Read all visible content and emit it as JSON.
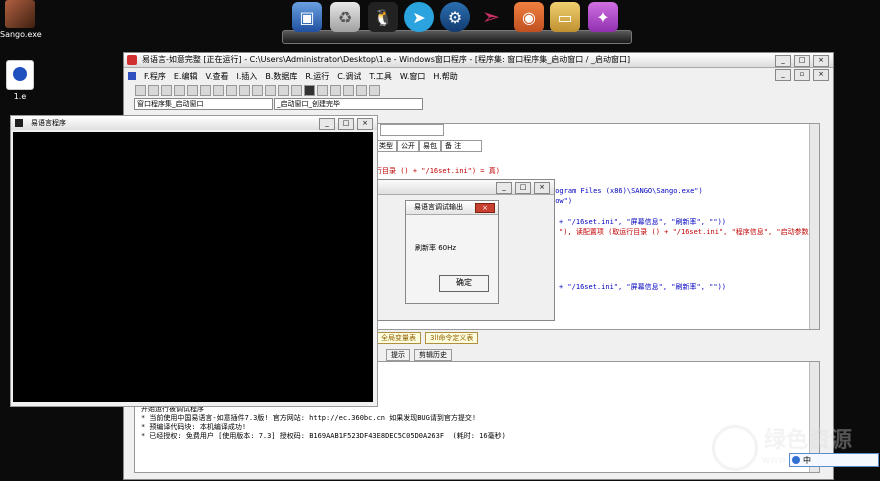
{
  "desktop": {
    "icons": [
      {
        "label": "Sango.exe"
      },
      {
        "label": "1.e"
      }
    ]
  },
  "dock": {
    "items": [
      {
        "name": "computer"
      },
      {
        "name": "recycle-bin"
      },
      {
        "name": "qq"
      },
      {
        "name": "telegram"
      },
      {
        "name": "steam"
      },
      {
        "name": "send"
      },
      {
        "name": "disk"
      },
      {
        "name": "folder"
      },
      {
        "name": "tools"
      }
    ]
  },
  "ide": {
    "title": "易语言-如意完整 [正在运行] - C:\\Users\\Administrator\\Desktop\\1.e - Windows窗口程序 - [程序集: 窗口程序集_启动窗口 / _启动窗口]",
    "menu": [
      "F.程序",
      "E.编辑",
      "V.查看",
      "I.插入",
      "B.数据库",
      "R.运行",
      "C.调试",
      "T.工具",
      "W.窗口",
      "H.帮助"
    ],
    "selector_left": "窗口程序集_启动窗口",
    "selector_right": "_启动窗口_创建完毕",
    "table_header": [
      "类型",
      "公开",
      "易包",
      "备 注"
    ],
    "code_lines": [
      {
        "text": "行目录 () + \"/16set.ini\") = 真)"
      },
      {
        "text": "rogram Files (x86)\\SANGO\\Sango.exe\")"
      },
      {
        "text": "dow\")"
      },
      {
        "text": "+ \"/16set.ini\", \"屏幕信息\", \"刷新率\", \"\"))"
      },
      {
        "text": "\"), 读配置项 (取运行目录 () + \"/16set.ini\", \"程序信息\", \"启动参数\""
      },
      {
        "text": "+ \"/16set.ini\", \"屏幕信息\", \"刷新率\", \"\"))"
      }
    ],
    "tabs": [
      "全局变量表",
      "3ll命令定义表"
    ],
    "bottom_tabs": [
      "提示",
      "剪辑历史"
    ],
    "log_lines": [
      "开始运行被调试程序",
      "* 当前使用中国易语言-如意插件7.3版! 官方网站: http://ec.360bc.cn 如果发现BUG请到官方提交!",
      "* 预编译代码块: 本机编译成功!",
      "* 已经授权: 免费用户 [使用版本: 7.3] 授权码: B169AAB1F523DF43E8DEC5C05D0A263F  (耗时: 16毫秒)"
    ]
  },
  "console": {
    "title": "易语言程序"
  },
  "small_window": {},
  "dialog": {
    "title": "易语言调试输出",
    "message": "刷新率  60Hz",
    "ok": "确定"
  },
  "watermark": {
    "brand": "绿色资源",
    "url": "www.greenxf.com"
  },
  "ime": {
    "label": "中"
  },
  "colors": {
    "desktop": "#0b0b0b",
    "console": "#000000",
    "string_literal": "#0000c0",
    "keyword": "#c00000"
  }
}
